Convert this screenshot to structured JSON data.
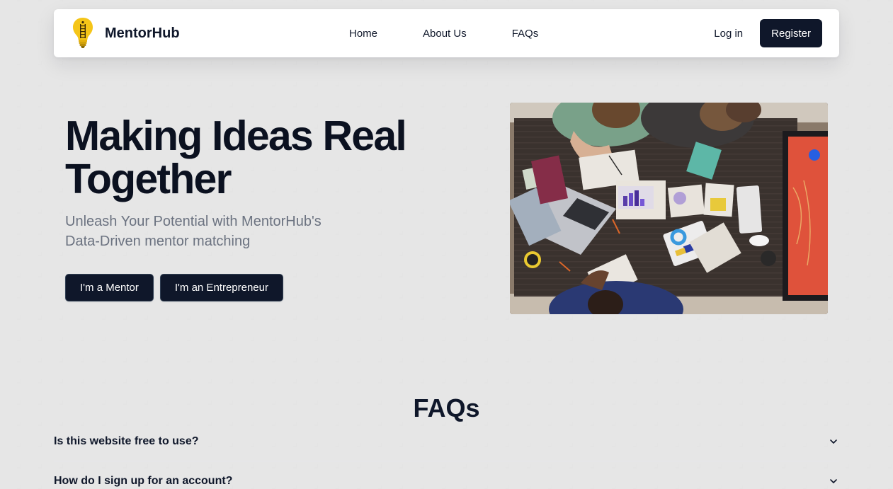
{
  "brand": {
    "name": "MentorHub",
    "icon": "lightbulb-icon"
  },
  "nav": {
    "links": [
      "Home",
      "About Us",
      "FAQs"
    ],
    "login_label": "Log in",
    "register_label": "Register"
  },
  "hero": {
    "title_line1": "Making Ideas Real",
    "title_line2": "Together",
    "subtitle_line1": "Unleash Your Potential with MentorHub's",
    "subtitle_line2": "Data-Driven mentor matching",
    "mentor_button": "I'm a Mentor",
    "entrepreneur_button": "I'm an Entrepreneur"
  },
  "faq": {
    "heading": "FAQs",
    "items": [
      "Is this website free to use?",
      "How do I sign up for an account?"
    ]
  },
  "colors": {
    "primary": "#0f172a",
    "muted_text": "#6b7280",
    "bulb_yellow": "#f5c518"
  }
}
